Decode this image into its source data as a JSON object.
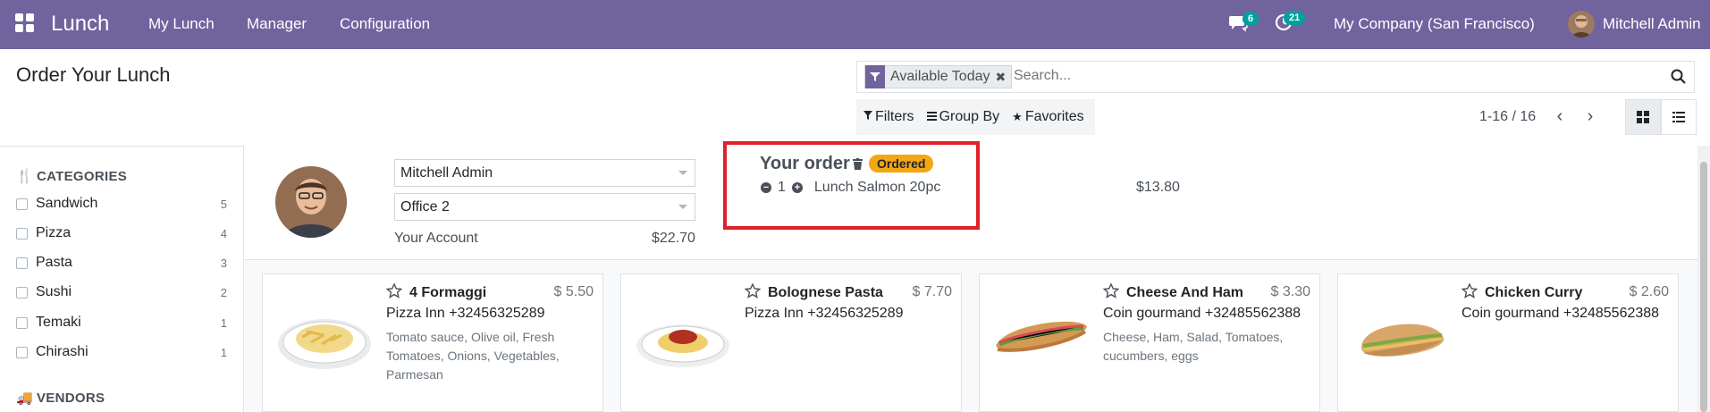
{
  "nav": {
    "app_name": "Lunch",
    "menu": [
      "My Lunch",
      "Manager",
      "Configuration"
    ],
    "messages_count": "6",
    "activities_count": "21",
    "company": "My Company (San Francisco)",
    "user": "Mitchell Admin",
    "accent_color": "#71639e"
  },
  "page": {
    "title": "Order Your Lunch"
  },
  "search": {
    "facet_label": "Available Today",
    "placeholder": "Search...",
    "filters_label": "Filters",
    "groupby_label": "Group By",
    "favorites_label": "Favorites"
  },
  "pager": {
    "text": "1-16 / 16"
  },
  "sidebar": {
    "categories_title": "CATEGORIES",
    "categories": [
      {
        "label": "Sandwich",
        "count": "5"
      },
      {
        "label": "Pizza",
        "count": "4"
      },
      {
        "label": "Pasta",
        "count": "3"
      },
      {
        "label": "Sushi",
        "count": "2"
      },
      {
        "label": "Temaki",
        "count": "1"
      },
      {
        "label": "Chirashi",
        "count": "1"
      }
    ],
    "vendors_title": "VENDORS"
  },
  "user_panel": {
    "user_select": "Mitchell Admin",
    "location_select": "Office 2",
    "account_label": "Your Account",
    "account_value": "$22.70"
  },
  "order": {
    "title": "Your order",
    "status": "Ordered",
    "quantity": "1",
    "product": "Lunch Salmon 20pc",
    "price": "$13.80",
    "highlight_color": "#e0202a"
  },
  "products": [
    {
      "name": "4 Formaggi",
      "price": "$ 5.50",
      "vendor": "Pizza Inn +32456325289",
      "desc": "Tomato sauce, Olive oil, Fresh Tomatoes, Onions, Vegetables, Parmesan",
      "image": "pasta-plate"
    },
    {
      "name": "Bolognese Pasta",
      "price": "$ 7.70",
      "vendor": "Pizza Inn +32456325289",
      "desc": "",
      "image": "bolognese-plate"
    },
    {
      "name": "Cheese And Ham",
      "price": "$ 3.30",
      "vendor": "Coin gourmand +32485562388",
      "desc": "Cheese, Ham, Salad, Tomatoes, cucumbers, eggs",
      "image": "baguette-sandwich"
    },
    {
      "name": "Chicken Curry",
      "price": "$ 2.60",
      "vendor": "Coin gourmand +32485562388",
      "desc": "",
      "image": "bun-sandwich"
    }
  ]
}
